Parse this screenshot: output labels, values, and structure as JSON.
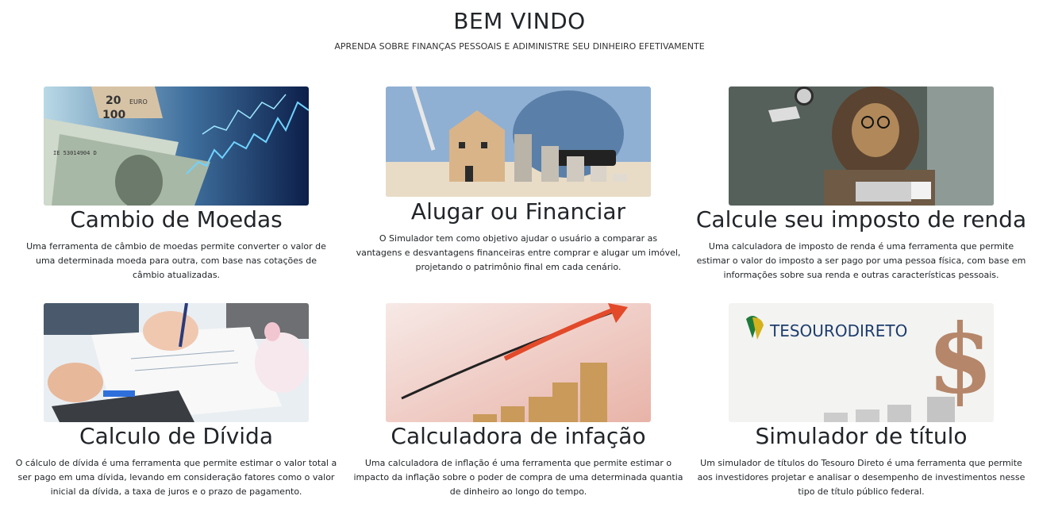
{
  "header": {
    "title": "BEM VINDO",
    "subtitle": "APRENDA SOBRE FINANÇAS PESSOAIS E ADIMINISTRE SEU DINHEIRO EFETIVAMENTE"
  },
  "cards": [
    {
      "title": "Cambio de Moedas",
      "description": "Uma ferramenta de câmbio de moedas permite converter o valor de uma determinada moeda para outra, com base nas cotações de câmbio atualizadas.",
      "image_text": [
        "20",
        "EURO",
        "100",
        "IE 53014904 D"
      ]
    },
    {
      "title": "Alugar ou Financiar",
      "description": "O Simulador tem como objetivo ajudar o usuário a comparar as vantagens e desvantagens financeiras entre comprar e alugar um imóvel, projetando o patrimônio final em cada cenário."
    },
    {
      "title": "Calcule seu imposto de renda",
      "description": "Uma calculadora de imposto de renda é uma ferramenta que permite estimar o valor do imposto a ser pago por uma pessoa física, com base em informações sobre sua renda e outras características pessoais."
    },
    {
      "title": "Calculo de Dívida",
      "description": "O cálculo de dívida é uma ferramenta que permite estimar o valor total a ser pago em uma dívida, levando em consideração fatores como o valor inicial da dívida, a taxa de juros e o prazo de pagamento."
    },
    {
      "title": "Calculadora de infação",
      "description": "Uma calculadora de inflação é uma ferramenta que permite estimar o impacto da inflação sobre o poder de compra de uma determinada quantia de dinheiro ao longo do tempo."
    },
    {
      "title": "Simulador de título",
      "description": "Um simulador de títulos do Tesouro Direto é uma ferramenta que permite aos investidores projetar e analisar o desempenho de investimentos nesse tipo de título público federal.",
      "image_text": "TESOURODIRETO"
    }
  ]
}
